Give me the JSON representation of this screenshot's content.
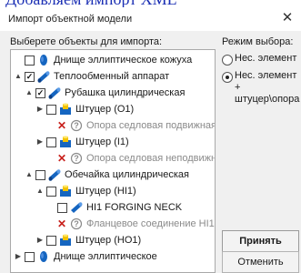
{
  "top_caption": "Добавляем импорт XML",
  "window": {
    "title": "Импорт объектной модели",
    "close_label": "✕"
  },
  "left_panel": {
    "label": "Выберете объекты для импорта:"
  },
  "tree": [
    {
      "expander": "",
      "mark": "checkbox",
      "checked": false,
      "icon": "cylinder-head-icon",
      "label": "Днище эллиптическое кожуха",
      "grey": false
    },
    {
      "expander": "▲",
      "mark": "checkbox",
      "checked": true,
      "icon": "heat-exchanger-icon",
      "label": "Теплообменный аппарат",
      "grey": false
    },
    {
      "expander": "▲",
      "mark": "checkbox",
      "checked": true,
      "icon": "cylinder-shell-icon",
      "label": "Рубашка цилиндрическая",
      "grey": false
    },
    {
      "expander": "▶",
      "mark": "checkbox",
      "checked": false,
      "icon": "nozzle-icon",
      "label": "Штуцер (O1)",
      "grey": false
    },
    {
      "expander": "",
      "mark": "x",
      "checked": false,
      "icon": "question-icon",
      "label": "Опора седловая подвижная",
      "grey": true
    },
    {
      "expander": "▶",
      "mark": "checkbox",
      "checked": false,
      "icon": "nozzle-icon",
      "label": "Штуцер (I1)",
      "grey": false
    },
    {
      "expander": "",
      "mark": "x",
      "checked": false,
      "icon": "question-icon",
      "label": "Опора седловая неподвижная",
      "grey": true
    },
    {
      "expander": "▲",
      "mark": "checkbox",
      "checked": false,
      "icon": "cylinder-shell-icon",
      "label": "Обечайка цилиндрическая",
      "grey": false
    },
    {
      "expander": "▲",
      "mark": "checkbox",
      "checked": false,
      "icon": "nozzle-icon",
      "label": "Штуцер (HI1)",
      "grey": false
    },
    {
      "expander": "",
      "mark": "checkbox",
      "checked": false,
      "icon": "neck-icon",
      "label": "HI1 FORGING NECK",
      "grey": false
    },
    {
      "expander": "",
      "mark": "x",
      "checked": false,
      "icon": "question-icon",
      "label": "Фланцевое соединение HI1",
      "grey": true
    },
    {
      "expander": "▶",
      "mark": "checkbox",
      "checked": false,
      "icon": "nozzle-icon",
      "label": "Штуцер (HO1)",
      "grey": false
    },
    {
      "expander": "▶",
      "mark": "checkbox",
      "checked": false,
      "icon": "cylinder-head-icon",
      "label": "Днище эллиптическое",
      "grey": false
    }
  ],
  "mode": {
    "label": "Режим выбора:",
    "options": [
      {
        "line1": "Нес. элемент",
        "line2": "",
        "selected": false
      },
      {
        "line1": "Нес. элемент +",
        "line2": "штуцер\\опора",
        "selected": true
      }
    ]
  },
  "buttons": {
    "accept": "Принять",
    "cancel": "Отменить"
  },
  "colors": {
    "accent": "#1565c0",
    "nozzle_yellow": "#f2c200",
    "error_red": "#c8201c"
  }
}
